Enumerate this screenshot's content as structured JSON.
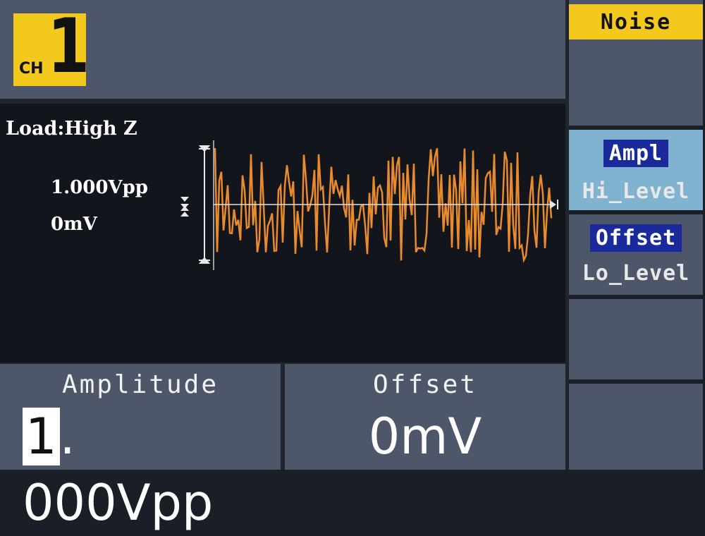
{
  "channel": {
    "prefix": "CH",
    "number": "1"
  },
  "display": {
    "load": "Load:High Z",
    "amplitude_label": "1.000Vpp",
    "offset_label": "0mV",
    "wave_color": "#e98a2c"
  },
  "params": {
    "amplitude": {
      "title": "Amplitude",
      "value_cursor": "1",
      "value_rest": ". 000Vpp"
    },
    "offset": {
      "title": "Offset",
      "value": "0mV"
    }
  },
  "softkeys": {
    "menu_title": "Noise",
    "ampl": {
      "primary": "Ampl",
      "secondary": "Hi_Level"
    },
    "offset": {
      "primary": "Offset",
      "secondary": "Lo_Level"
    }
  },
  "colors": {
    "accent": "#f2c91c",
    "panel": "#4e5669",
    "screen": "#12151b",
    "active_key": "#7fb3cf",
    "selected_text_bg": "#1b2a9a"
  }
}
